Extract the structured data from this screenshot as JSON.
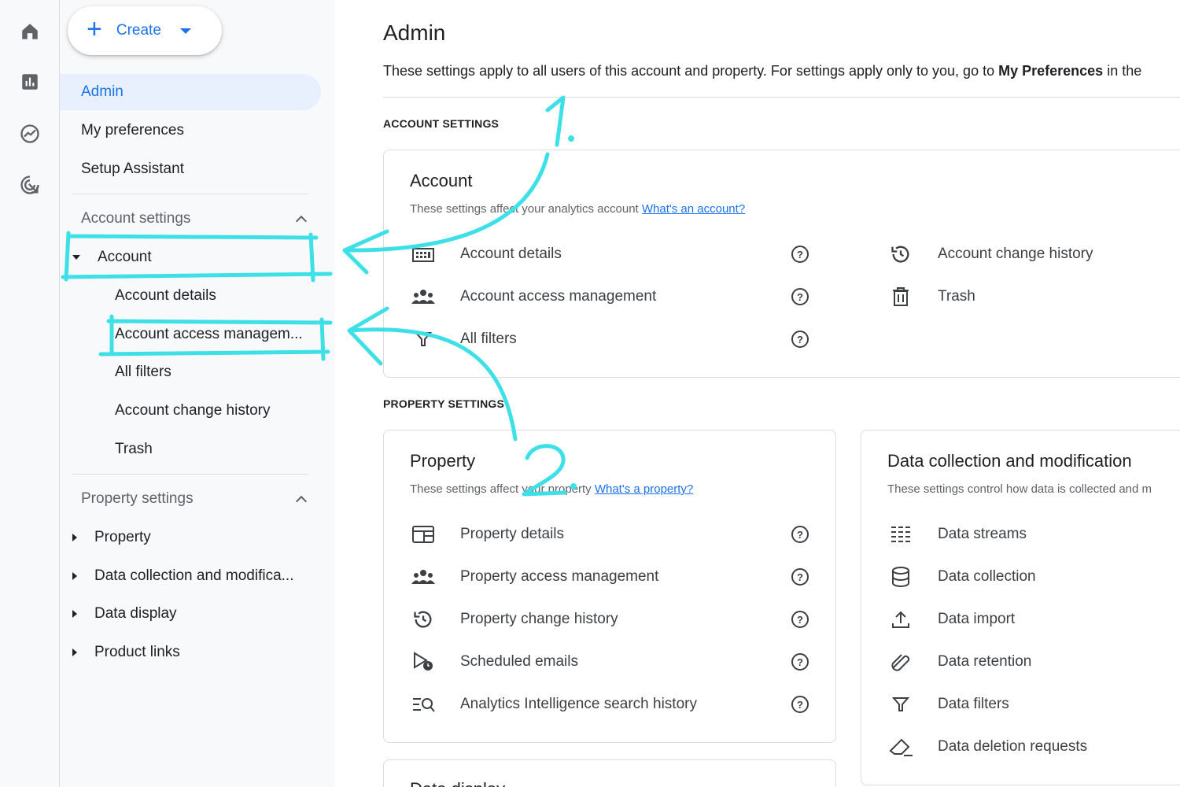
{
  "rail": {
    "icons": [
      "home-icon",
      "reports-icon",
      "explore-icon",
      "advertising-icon"
    ]
  },
  "sidenav": {
    "create_label": "Create",
    "top_items": [
      "Admin",
      "My preferences",
      "Setup Assistant"
    ],
    "account_settings": {
      "heading": "Account settings",
      "group_label": "Account",
      "children": [
        "Account details",
        "Account access managem...",
        "All filters",
        "Account change history",
        "Trash"
      ]
    },
    "property_settings": {
      "heading": "Property settings",
      "groups": [
        "Property",
        "Data collection and modifica...",
        "Data display",
        "Product links"
      ]
    }
  },
  "main": {
    "title": "Admin",
    "description_prefix": "These settings apply to all users of this account and property. For settings apply only to you, go to ",
    "description_bold": "My Preferences",
    "description_suffix": " in the",
    "account_section_label": "ACCOUNT SETTINGS",
    "property_section_label": "PROPERTY SETTINGS",
    "account_card": {
      "title": "Account",
      "subtitle": "These settings affect your analytics account ",
      "link": "What's an account?",
      "left_rows": [
        {
          "label": "Account details",
          "icon": "building-icon"
        },
        {
          "label": "Account access management",
          "icon": "people-icon"
        },
        {
          "label": "All filters",
          "icon": "filter-icon"
        }
      ],
      "right_rows": [
        {
          "label": "Account change history",
          "icon": "history-icon"
        },
        {
          "label": "Trash",
          "icon": "trash-icon"
        }
      ]
    },
    "property_card": {
      "title": "Property",
      "subtitle": "These settings affect your property ",
      "link": "What's a property?",
      "rows": [
        {
          "label": "Property details",
          "icon": "property-details-icon"
        },
        {
          "label": "Property access management",
          "icon": "people-icon"
        },
        {
          "label": "Property change history",
          "icon": "history-icon"
        },
        {
          "label": "Scheduled emails",
          "icon": "scheduled-email-icon"
        },
        {
          "label": "Analytics Intelligence search history",
          "icon": "search-history-icon"
        }
      ]
    },
    "data_card": {
      "title": "Data collection and modification",
      "subtitle": "These settings control how data is collected and m",
      "rows": [
        {
          "label": "Data streams",
          "icon": "data-streams-icon"
        },
        {
          "label": "Data collection",
          "icon": "database-icon"
        },
        {
          "label": "Data import",
          "icon": "upload-icon"
        },
        {
          "label": "Data retention",
          "icon": "retention-icon"
        },
        {
          "label": "Data filters",
          "icon": "filter-icon"
        },
        {
          "label": "Data deletion requests",
          "icon": "eraser-icon"
        }
      ]
    },
    "third_card_title": "Data display"
  },
  "annotations": {
    "step1": "1.",
    "step2": "2.",
    "color": "#3ee0e8"
  }
}
